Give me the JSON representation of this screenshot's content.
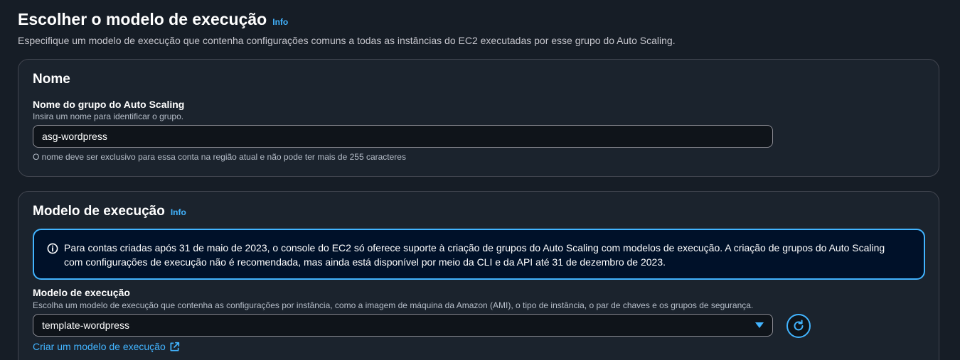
{
  "header": {
    "title": "Escolher o modelo de execução",
    "info": "Info",
    "description": "Especifique um modelo de execução que contenha configurações comuns a todas as instâncias do EC2 executadas por esse grupo do Auto Scaling."
  },
  "name_section": {
    "title": "Nome",
    "field_label": "Nome do grupo do Auto Scaling",
    "field_description": "Insira um nome para identificar o grupo.",
    "field_value": "asg-wordpress",
    "field_hint": "O nome deve ser exclusivo para essa conta na região atual e não pode ter mais de 255 caracteres"
  },
  "launch_section": {
    "title": "Modelo de execução",
    "info": "Info",
    "alert_line1": "Para contas criadas após 31 de maio de 2023, o console do EC2 só oferece suporte à criação de grupos do Auto Scaling com modelos de execução. A criação de grupos do Auto Scaling",
    "alert_line2": "com configurações de execução não é recomendada, mas ainda está disponível por meio da CLI e da API até 31 de dezembro de 2023.",
    "field_label": "Modelo de execução",
    "field_description": "Escolha um modelo de execução que contenha as configurações por instância, como a imagem de máquina da Amazon (AMI), o tipo de instância, o par de chaves e os grupos de segurança.",
    "selected_value": "template-wordpress",
    "create_link": "Criar um modelo de execução"
  },
  "icons": {
    "info": "info-circle-icon",
    "dropdown": "caret-down-icon",
    "refresh": "refresh-icon",
    "external": "external-link-icon"
  },
  "colors": {
    "background": "#161d26",
    "card": "#1b232d",
    "accent": "#42b4ff",
    "alert_bg": "#001129"
  }
}
